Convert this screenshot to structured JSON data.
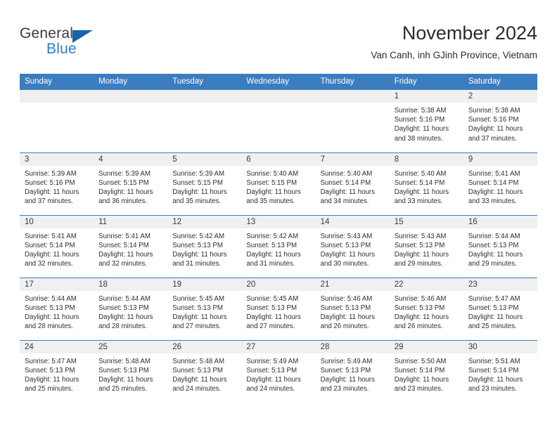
{
  "brand": {
    "name_top": "General",
    "name_bottom": "Blue",
    "accent_color": "#2a7fc9",
    "triangle_color": "#1565a8"
  },
  "header": {
    "title": "November 2024",
    "subtitle": "Van Canh, inh GJinh Province, Vietnam"
  },
  "theme": {
    "header_row_bg": "#3b7dbf",
    "daynum_band_bg": "#f0f0f0",
    "row_border": "#3b7dbf"
  },
  "weekday_headers": [
    "Sunday",
    "Monday",
    "Tuesday",
    "Wednesday",
    "Thursday",
    "Friday",
    "Saturday"
  ],
  "weeks": [
    [
      {
        "day": "",
        "empty": true,
        "sunrise": "",
        "sunset": "",
        "daylight_1": "",
        "daylight_2": ""
      },
      {
        "day": "",
        "empty": true,
        "sunrise": "",
        "sunset": "",
        "daylight_1": "",
        "daylight_2": ""
      },
      {
        "day": "",
        "empty": true,
        "sunrise": "",
        "sunset": "",
        "daylight_1": "",
        "daylight_2": ""
      },
      {
        "day": "",
        "empty": true,
        "sunrise": "",
        "sunset": "",
        "daylight_1": "",
        "daylight_2": ""
      },
      {
        "day": "",
        "empty": true,
        "sunrise": "",
        "sunset": "",
        "daylight_1": "",
        "daylight_2": ""
      },
      {
        "day": "1",
        "empty": false,
        "sunrise": "Sunrise: 5:38 AM",
        "sunset": "Sunset: 5:16 PM",
        "daylight_1": "Daylight: 11 hours",
        "daylight_2": "and 38 minutes."
      },
      {
        "day": "2",
        "empty": false,
        "sunrise": "Sunrise: 5:38 AM",
        "sunset": "Sunset: 5:16 PM",
        "daylight_1": "Daylight: 11 hours",
        "daylight_2": "and 37 minutes."
      }
    ],
    [
      {
        "day": "3",
        "empty": false,
        "sunrise": "Sunrise: 5:39 AM",
        "sunset": "Sunset: 5:16 PM",
        "daylight_1": "Daylight: 11 hours",
        "daylight_2": "and 37 minutes."
      },
      {
        "day": "4",
        "empty": false,
        "sunrise": "Sunrise: 5:39 AM",
        "sunset": "Sunset: 5:15 PM",
        "daylight_1": "Daylight: 11 hours",
        "daylight_2": "and 36 minutes."
      },
      {
        "day": "5",
        "empty": false,
        "sunrise": "Sunrise: 5:39 AM",
        "sunset": "Sunset: 5:15 PM",
        "daylight_1": "Daylight: 11 hours",
        "daylight_2": "and 35 minutes."
      },
      {
        "day": "6",
        "empty": false,
        "sunrise": "Sunrise: 5:40 AM",
        "sunset": "Sunset: 5:15 PM",
        "daylight_1": "Daylight: 11 hours",
        "daylight_2": "and 35 minutes."
      },
      {
        "day": "7",
        "empty": false,
        "sunrise": "Sunrise: 5:40 AM",
        "sunset": "Sunset: 5:14 PM",
        "daylight_1": "Daylight: 11 hours",
        "daylight_2": "and 34 minutes."
      },
      {
        "day": "8",
        "empty": false,
        "sunrise": "Sunrise: 5:40 AM",
        "sunset": "Sunset: 5:14 PM",
        "daylight_1": "Daylight: 11 hours",
        "daylight_2": "and 33 minutes."
      },
      {
        "day": "9",
        "empty": false,
        "sunrise": "Sunrise: 5:41 AM",
        "sunset": "Sunset: 5:14 PM",
        "daylight_1": "Daylight: 11 hours",
        "daylight_2": "and 33 minutes."
      }
    ],
    [
      {
        "day": "10",
        "empty": false,
        "sunrise": "Sunrise: 5:41 AM",
        "sunset": "Sunset: 5:14 PM",
        "daylight_1": "Daylight: 11 hours",
        "daylight_2": "and 32 minutes."
      },
      {
        "day": "11",
        "empty": false,
        "sunrise": "Sunrise: 5:41 AM",
        "sunset": "Sunset: 5:14 PM",
        "daylight_1": "Daylight: 11 hours",
        "daylight_2": "and 32 minutes."
      },
      {
        "day": "12",
        "empty": false,
        "sunrise": "Sunrise: 5:42 AM",
        "sunset": "Sunset: 5:13 PM",
        "daylight_1": "Daylight: 11 hours",
        "daylight_2": "and 31 minutes."
      },
      {
        "day": "13",
        "empty": false,
        "sunrise": "Sunrise: 5:42 AM",
        "sunset": "Sunset: 5:13 PM",
        "daylight_1": "Daylight: 11 hours",
        "daylight_2": "and 31 minutes."
      },
      {
        "day": "14",
        "empty": false,
        "sunrise": "Sunrise: 5:43 AM",
        "sunset": "Sunset: 5:13 PM",
        "daylight_1": "Daylight: 11 hours",
        "daylight_2": "and 30 minutes."
      },
      {
        "day": "15",
        "empty": false,
        "sunrise": "Sunrise: 5:43 AM",
        "sunset": "Sunset: 5:13 PM",
        "daylight_1": "Daylight: 11 hours",
        "daylight_2": "and 29 minutes."
      },
      {
        "day": "16",
        "empty": false,
        "sunrise": "Sunrise: 5:44 AM",
        "sunset": "Sunset: 5:13 PM",
        "daylight_1": "Daylight: 11 hours",
        "daylight_2": "and 29 minutes."
      }
    ],
    [
      {
        "day": "17",
        "empty": false,
        "sunrise": "Sunrise: 5:44 AM",
        "sunset": "Sunset: 5:13 PM",
        "daylight_1": "Daylight: 11 hours",
        "daylight_2": "and 28 minutes."
      },
      {
        "day": "18",
        "empty": false,
        "sunrise": "Sunrise: 5:44 AM",
        "sunset": "Sunset: 5:13 PM",
        "daylight_1": "Daylight: 11 hours",
        "daylight_2": "and 28 minutes."
      },
      {
        "day": "19",
        "empty": false,
        "sunrise": "Sunrise: 5:45 AM",
        "sunset": "Sunset: 5:13 PM",
        "daylight_1": "Daylight: 11 hours",
        "daylight_2": "and 27 minutes."
      },
      {
        "day": "20",
        "empty": false,
        "sunrise": "Sunrise: 5:45 AM",
        "sunset": "Sunset: 5:13 PM",
        "daylight_1": "Daylight: 11 hours",
        "daylight_2": "and 27 minutes."
      },
      {
        "day": "21",
        "empty": false,
        "sunrise": "Sunrise: 5:46 AM",
        "sunset": "Sunset: 5:13 PM",
        "daylight_1": "Daylight: 11 hours",
        "daylight_2": "and 26 minutes."
      },
      {
        "day": "22",
        "empty": false,
        "sunrise": "Sunrise: 5:46 AM",
        "sunset": "Sunset: 5:13 PM",
        "daylight_1": "Daylight: 11 hours",
        "daylight_2": "and 26 minutes."
      },
      {
        "day": "23",
        "empty": false,
        "sunrise": "Sunrise: 5:47 AM",
        "sunset": "Sunset: 5:13 PM",
        "daylight_1": "Daylight: 11 hours",
        "daylight_2": "and 25 minutes."
      }
    ],
    [
      {
        "day": "24",
        "empty": false,
        "sunrise": "Sunrise: 5:47 AM",
        "sunset": "Sunset: 5:13 PM",
        "daylight_1": "Daylight: 11 hours",
        "daylight_2": "and 25 minutes."
      },
      {
        "day": "25",
        "empty": false,
        "sunrise": "Sunrise: 5:48 AM",
        "sunset": "Sunset: 5:13 PM",
        "daylight_1": "Daylight: 11 hours",
        "daylight_2": "and 25 minutes."
      },
      {
        "day": "26",
        "empty": false,
        "sunrise": "Sunrise: 5:48 AM",
        "sunset": "Sunset: 5:13 PM",
        "daylight_1": "Daylight: 11 hours",
        "daylight_2": "and 24 minutes."
      },
      {
        "day": "27",
        "empty": false,
        "sunrise": "Sunrise: 5:49 AM",
        "sunset": "Sunset: 5:13 PM",
        "daylight_1": "Daylight: 11 hours",
        "daylight_2": "and 24 minutes."
      },
      {
        "day": "28",
        "empty": false,
        "sunrise": "Sunrise: 5:49 AM",
        "sunset": "Sunset: 5:13 PM",
        "daylight_1": "Daylight: 11 hours",
        "daylight_2": "and 23 minutes."
      },
      {
        "day": "29",
        "empty": false,
        "sunrise": "Sunrise: 5:50 AM",
        "sunset": "Sunset: 5:14 PM",
        "daylight_1": "Daylight: 11 hours",
        "daylight_2": "and 23 minutes."
      },
      {
        "day": "30",
        "empty": false,
        "sunrise": "Sunrise: 5:51 AM",
        "sunset": "Sunset: 5:14 PM",
        "daylight_1": "Daylight: 11 hours",
        "daylight_2": "and 23 minutes."
      }
    ]
  ]
}
